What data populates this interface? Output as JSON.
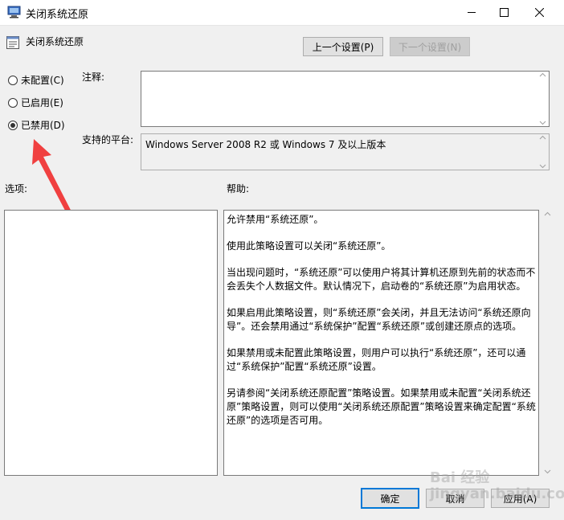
{
  "window": {
    "title": "关闭系统还原",
    "colors": {
      "accent": "#0078d7",
      "arrow": "#f04040"
    }
  },
  "header": {
    "policy_name": "关闭系统还原",
    "prev_button": "上一个设置(P)",
    "next_button": "下一个设置(N)"
  },
  "state": {
    "options": [
      {
        "label": "未配置(C)",
        "checked": false
      },
      {
        "label": "已启用(E)",
        "checked": false
      },
      {
        "label": "已禁用(D)",
        "checked": true
      }
    ]
  },
  "comment": {
    "label": "注释:",
    "value": ""
  },
  "platform": {
    "label": "支持的平台:",
    "value": "Windows Server 2008 R2 或 Windows 7 及以上版本"
  },
  "options_section": {
    "label": "选项:"
  },
  "help_section": {
    "label": "帮助:",
    "paragraphs": [
      "允许禁用“系统还原”。",
      "使用此策略设置可以关闭“系统还原”。",
      "当出现问题时，“系统还原”可以使用户将其计算机还原到先前的状态而不会丢失个人数据文件。默认情况下，启动卷的“系统还原”为启用状态。",
      "如果启用此策略设置，则“系统还原”会关闭，并且无法访问“系统还原向导”。还会禁用通过“系统保护”配置“系统还原”或创建还原点的选项。",
      "如果禁用或未配置此策略设置，则用户可以执行“系统还原”，还可以通过“系统保护”配置“系统还原”设置。",
      "另请参阅“关闭系统还原配置”策略设置。如果禁用或未配置“关闭系统还原”策略设置，则可以使用“关闭系统还原配置”策略设置来确定配置“系统还原”的选项是否可用。"
    ]
  },
  "footer": {
    "ok_button": "确定",
    "cancel_button": "取消",
    "apply_button": "应用(A)"
  },
  "watermark": "Bai 经验 jingyan.baidu.com"
}
